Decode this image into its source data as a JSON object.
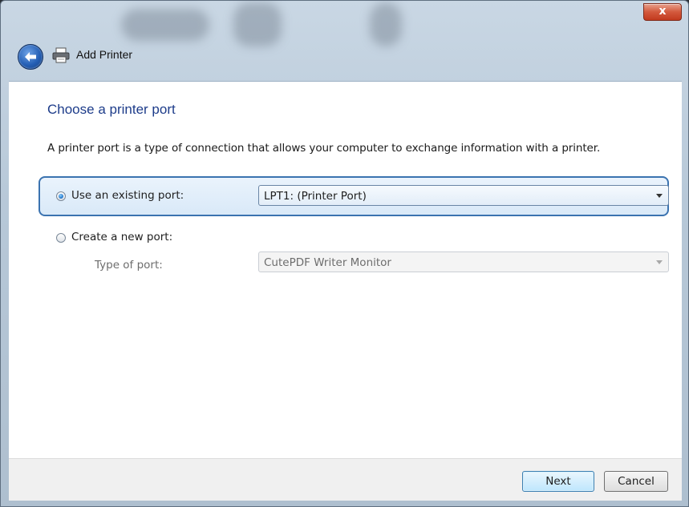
{
  "window": {
    "title": "Add Printer",
    "close_glyph": "x"
  },
  "page": {
    "heading": "Choose a printer port",
    "description": "A printer port is a type of connection that allows your computer to exchange information with a printer."
  },
  "options": {
    "existing": {
      "label": "Use an existing port:",
      "selected": true,
      "value": "LPT1: (Printer Port)"
    },
    "create": {
      "label": "Create a new port:",
      "selected": false,
      "type_label": "Type of port:",
      "type_value": "CutePDF Writer Monitor"
    }
  },
  "buttons": {
    "next": "Next",
    "cancel": "Cancel"
  },
  "colors": {
    "heading": "#1d3c8a",
    "selection_border": "#3b73b0",
    "close_button": "#c23a1e"
  }
}
